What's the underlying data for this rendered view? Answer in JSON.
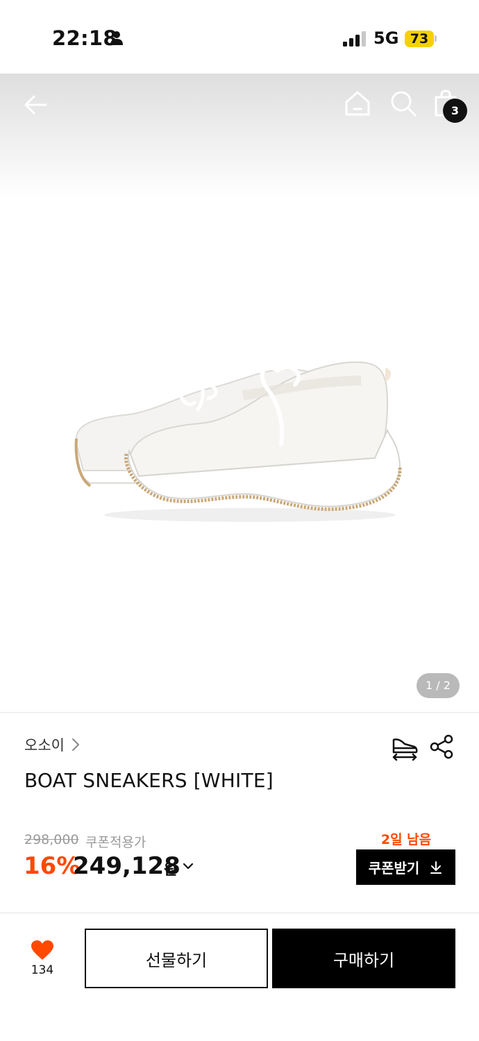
{
  "status_bar": {
    "time": "22:18",
    "network": "5G",
    "battery": "73",
    "battery_color": "#f5d100"
  },
  "nav": {
    "icons": [
      "back-arrow-icon",
      "home-icon",
      "search-icon",
      "shopping-bag-icon"
    ],
    "cart_count": "3"
  },
  "gallery": {
    "page_indicator": "1 / 2"
  },
  "product": {
    "brand": "오소이",
    "name": "BOAT SNEAKERS [WHITE]",
    "original_price": "298,000",
    "coupon_label": "쿠폰적용가",
    "discount": "16%",
    "sale_price": "249,128",
    "currency": "원",
    "accent_color": "#ff4800"
  },
  "coupon": {
    "days_left": "2일 남음",
    "button_label": "쿠폰받기"
  },
  "actions": {
    "like_count": "134",
    "gift_label": "선물하기",
    "buy_label": "구매하기",
    "like_color": "#ff4800"
  }
}
